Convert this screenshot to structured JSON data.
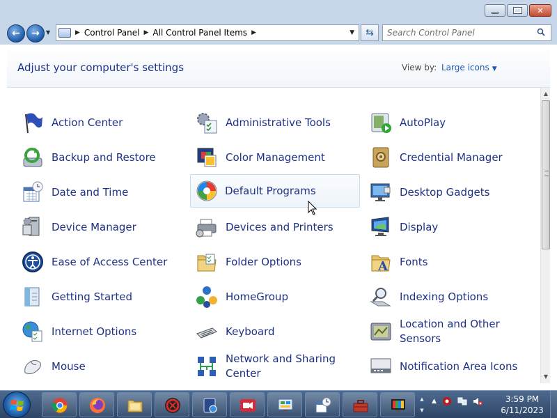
{
  "address": {
    "crumbs": [
      "Control Panel",
      "All Control Panel Items"
    ]
  },
  "search": {
    "placeholder": "Search Control Panel"
  },
  "header": {
    "title": "Adjust your computer's settings",
    "view_by_label": "View by:",
    "view_by_value": "Large icons"
  },
  "items": [
    {
      "label": "Action Center",
      "icon": "flag-icon"
    },
    {
      "label": "Administrative Tools",
      "icon": "admin-tools-icon"
    },
    {
      "label": "AutoPlay",
      "icon": "autoplay-icon"
    },
    {
      "label": "Backup and Restore",
      "icon": "backup-icon"
    },
    {
      "label": "Color Management",
      "icon": "color-management-icon"
    },
    {
      "label": "Credential Manager",
      "icon": "vault-icon"
    },
    {
      "label": "Date and Time",
      "icon": "calendar-clock-icon"
    },
    {
      "label": "Default Programs",
      "icon": "default-programs-icon"
    },
    {
      "label": "Desktop Gadgets",
      "icon": "gadgets-icon"
    },
    {
      "label": "Device Manager",
      "icon": "device-manager-icon"
    },
    {
      "label": "Devices and Printers",
      "icon": "printer-icon"
    },
    {
      "label": "Display",
      "icon": "monitor-icon"
    },
    {
      "label": "Ease of Access Center",
      "icon": "ease-of-access-icon"
    },
    {
      "label": "Folder Options",
      "icon": "folder-icon"
    },
    {
      "label": "Fonts",
      "icon": "fonts-icon"
    },
    {
      "label": "Getting Started",
      "icon": "getting-started-icon"
    },
    {
      "label": "HomeGroup",
      "icon": "homegroup-icon"
    },
    {
      "label": "Indexing Options",
      "icon": "indexing-icon"
    },
    {
      "label": "Internet Options",
      "icon": "globe-icon"
    },
    {
      "label": "Keyboard",
      "icon": "keyboard-icon"
    },
    {
      "label": "Location and Other Sensors",
      "icon": "sensors-icon"
    },
    {
      "label": "Mouse",
      "icon": "mouse-icon"
    },
    {
      "label": "Network and Sharing Center",
      "icon": "network-icon"
    },
    {
      "label": "Notification Area Icons",
      "icon": "notification-icon"
    }
  ],
  "taskbar": {
    "apps": [
      "chrome-icon",
      "firefox-icon",
      "explorer-folder-icon",
      "app-red-icon",
      "media-app-icon",
      "recorder-icon",
      "control-panel-icon",
      "date-time-app-icon",
      "toolbox-icon",
      "display-app-icon"
    ],
    "time": "3:59 PM",
    "date": "6/11/2023"
  }
}
